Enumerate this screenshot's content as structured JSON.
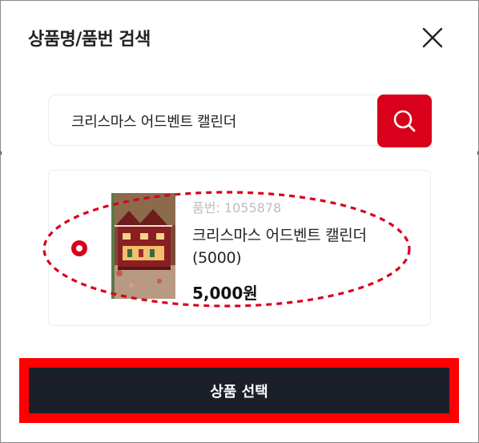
{
  "modal": {
    "title": "상품명/품번 검색"
  },
  "search": {
    "value": "크리스마스 어드벤트 캘린더"
  },
  "result": {
    "code": "품번: 1055878",
    "name": "크리스마스 어드벤트 캘린더 (5000)",
    "price": "5,000원",
    "selected": true
  },
  "footer": {
    "select_label": "상품 선택"
  },
  "colors": {
    "accent": "#d8001b",
    "button_dark": "#1b1f2a",
    "annotation": "#ff0000"
  },
  "icons": {
    "close": "close-icon",
    "search": "search-icon",
    "radio": "radio-selected-icon"
  }
}
